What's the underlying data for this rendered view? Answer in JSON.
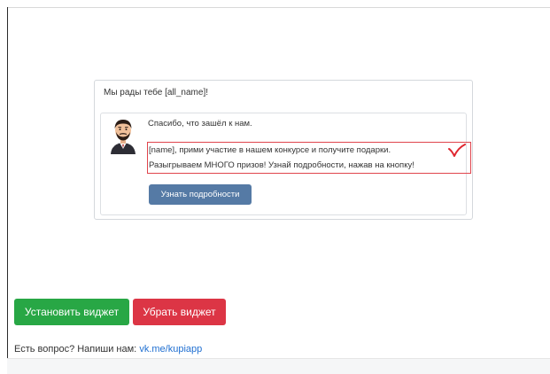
{
  "widget": {
    "greeting": "Мы рады тебе [all_name]!",
    "message": {
      "thanks": "Спасибо, что зашёл к нам.",
      "line1": "[name], прими участие в нашем конкурсе и получите подарки.",
      "line2": "Разыгрываем МНОГО призов! Узнай подробности, нажав на кнопку!",
      "button_label": "Узнать подробности"
    }
  },
  "actions": {
    "install_label": "Установить виджет",
    "remove_label": "Убрать виджет"
  },
  "footer": {
    "question_text": "Есть вопрос? Напиши нам: ",
    "link_text": "vk.me/kupiapp"
  },
  "colors": {
    "install": "#28a745",
    "remove": "#dc3545",
    "details_button": "#557aa5",
    "highlight": "#e0444c",
    "link": "#1f6fd1"
  },
  "icons": {
    "avatar": "bearded-man-avatar",
    "check": "red-check-mark"
  }
}
